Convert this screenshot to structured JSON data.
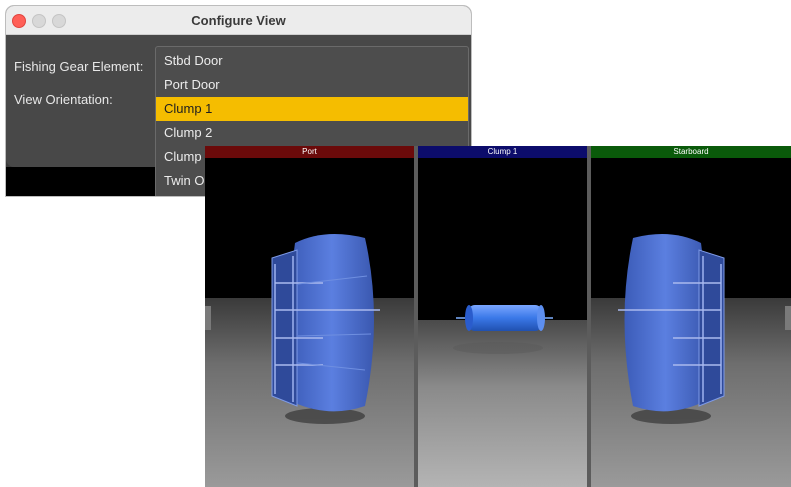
{
  "dialog": {
    "title": "Configure View",
    "fishing_gear_label": "Fishing Gear Element:",
    "view_orientation_label": "View Orientation:",
    "options": [
      "Stbd Door",
      "Port Door",
      "Clump 1",
      "Clump 2",
      "Clump",
      "Twin O"
    ],
    "selected_option": "Clump 1"
  },
  "viewer": {
    "panes": [
      {
        "label": "Port",
        "color": "#6b0a0a"
      },
      {
        "label": "Clump 1",
        "color": "#0c0c6b"
      },
      {
        "label": "Starboard",
        "color": "#0a5a0a"
      }
    ]
  },
  "colors": {
    "selection": "#f5bd00",
    "object_blue": "#4a6fd0",
    "background": "#000000"
  }
}
